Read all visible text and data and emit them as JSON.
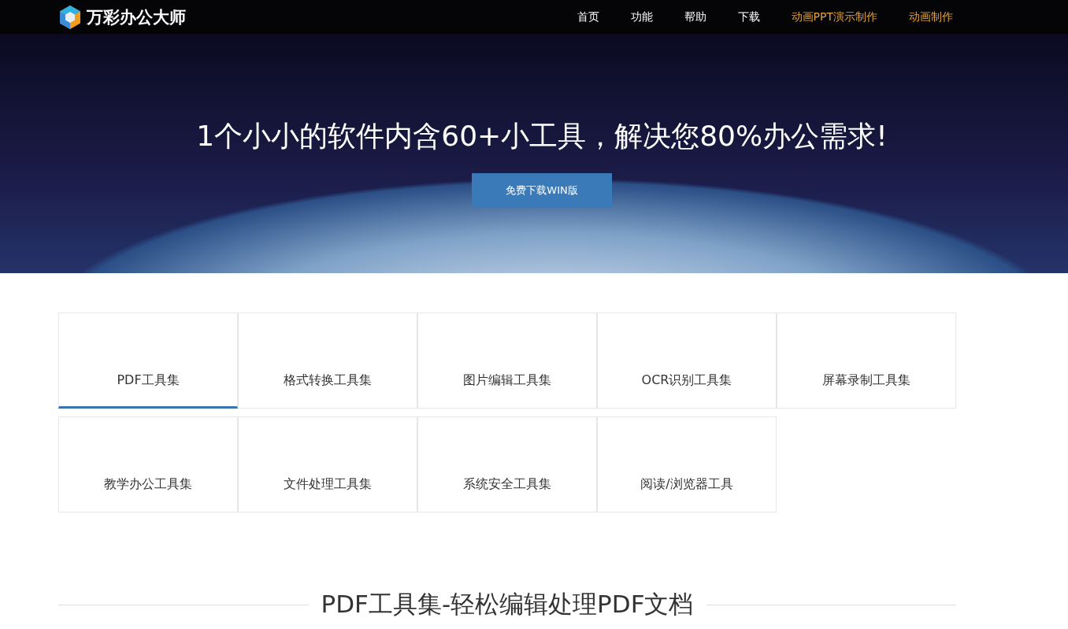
{
  "header": {
    "logo_text": "万彩办公大师",
    "nav": [
      {
        "label": "首页",
        "highlight": false
      },
      {
        "label": "功能",
        "highlight": false
      },
      {
        "label": "帮助",
        "highlight": false
      },
      {
        "label": "下载",
        "highlight": false
      },
      {
        "label": "动画PPT演示制作",
        "highlight": true
      },
      {
        "label": "动画制作",
        "highlight": true
      }
    ]
  },
  "hero": {
    "headline": "1个小小的软件内含60+小工具，解决您80%办公需求!",
    "button": "免费下载WIN版"
  },
  "tabs": [
    {
      "label": "PDF工具集",
      "selected": true
    },
    {
      "label": "格式转换工具集",
      "selected": false
    },
    {
      "label": "图片编辑工具集",
      "selected": false
    },
    {
      "label": "OCR识别工具集",
      "selected": false
    },
    {
      "label": "屏幕录制工具集",
      "selected": false
    },
    {
      "label": "教学办公工具集",
      "selected": false
    },
    {
      "label": "文件处理工具集",
      "selected": false
    },
    {
      "label": "系统安全工具集",
      "selected": false
    },
    {
      "label": "阅读/浏览器工具",
      "selected": false
    }
  ],
  "section_title": "PDF工具集-轻松编辑处理PDF文档"
}
